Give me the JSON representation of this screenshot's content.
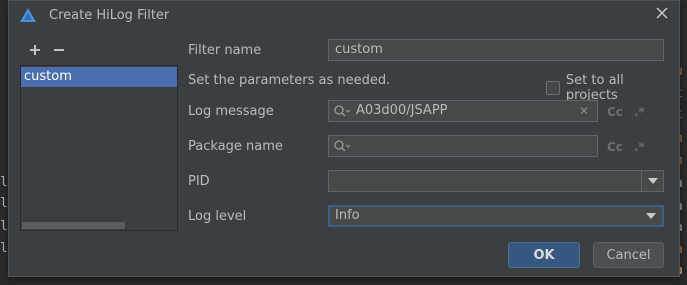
{
  "dialog": {
    "title": "Create HiLog Filter",
    "logo_icon": "harmony-logo-icon",
    "close_icon": "close-icon"
  },
  "filter_list": {
    "add_icon": "plus-icon",
    "remove_icon": "minus-icon",
    "items": [
      {
        "label": "custom"
      }
    ]
  },
  "form": {
    "filter_name_label": "Filter name",
    "filter_name_value": "custom",
    "hint": "Set the parameters as needed.",
    "set_all_projects_label": "Set to all projects",
    "log_message_label": "Log message",
    "log_message_value": "A03d00/JSAPP",
    "match_case": "Cc",
    "regex": ".*",
    "package_name_label": "Package name",
    "package_name_value": "",
    "pid_label": "PID",
    "pid_value": "",
    "log_level_label": "Log level",
    "log_level_value": "Info"
  },
  "buttons": {
    "ok": "OK",
    "cancel": "Cancel"
  },
  "colors": {
    "dialog_bg": "#3c3f41",
    "selection": "#4b6eaf",
    "ok_button": "#365880",
    "focus_border": "#3d6185"
  }
}
